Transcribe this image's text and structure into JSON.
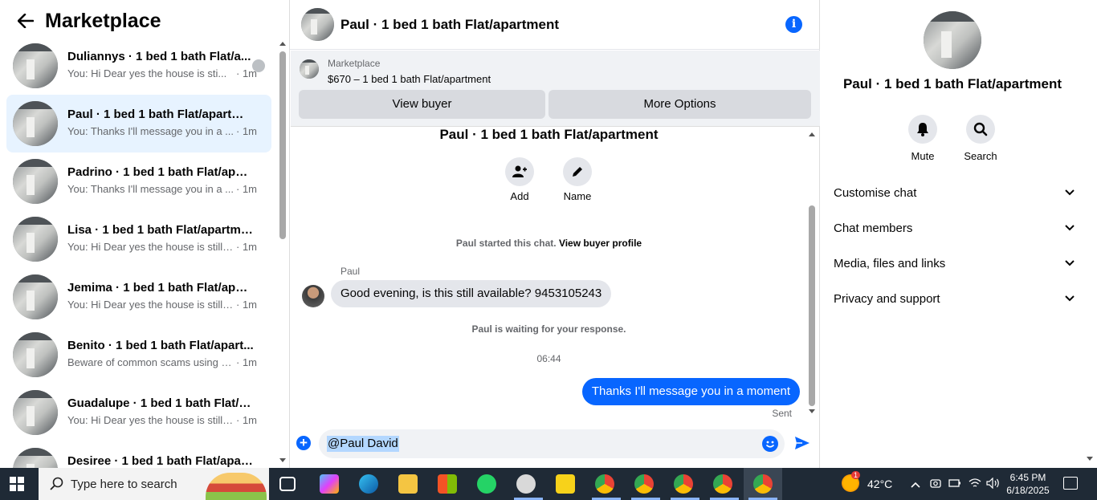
{
  "left": {
    "title": "Marketplace",
    "conversations": [
      {
        "name": "Duliannys · 1 bed 1 bath Flat/a...",
        "preview": "You: Hi Dear yes the house is sti...",
        "time": "· 1m",
        "seen": true
      },
      {
        "name": "Paul · 1 bed 1 bath Flat/apartment",
        "preview": "You: Thanks I'll message you in a ...",
        "time": "· 1m",
        "active": true
      },
      {
        "name": "Padrino · 1 bed 1 bath Flat/apart...",
        "preview": "You: Thanks I'll message you in a ...",
        "time": "· 1m"
      },
      {
        "name": "Lisa · 1 bed 1 bath Flat/apartment",
        "preview": "You: Hi Dear yes the house is still a...",
        "time": "· 1m"
      },
      {
        "name": "Jemima · 1 bed 1 bath Flat/apart...",
        "preview": "You: Hi Dear yes the house is still a...",
        "time": "· 1m"
      },
      {
        "name": "Benito · 1 bed 1 bath Flat/apart...",
        "preview": "Beware of common scams using p...",
        "time": "· 1m"
      },
      {
        "name": "Guadalupe · 1 bed 1 bath Flat/ap...",
        "preview": "You: Hi Dear yes the house is still a...",
        "time": "· 1m"
      },
      {
        "name": "Desiree · 1 bed 1 bath Flat/apart...",
        "preview": "",
        "time": ""
      }
    ]
  },
  "header": {
    "title": "Paul · 1 bed 1 bath Flat/apartment"
  },
  "marketplace_card": {
    "label": "Marketplace",
    "listing": "$670 – 1 bed 1 bath Flat/apartment",
    "view_buyer": "View buyer",
    "more_options": "More Options"
  },
  "chat": {
    "title": "Paul · 1 bed 1 bath Flat/apartment",
    "add_label": "Add",
    "name_label": "Name",
    "started_text": "Paul started this chat.",
    "view_profile": "View buyer profile",
    "sender": "Paul",
    "incoming": "Good evening, is this still available? 9453105243",
    "waiting": "Paul is waiting for your response.",
    "timestamp": "06:44",
    "outgoing": "Thanks I'll message you in a moment",
    "status": "Sent"
  },
  "composer": {
    "value": "@Paul David"
  },
  "right": {
    "name": "Paul · 1 bed 1 bath Flat/apartment",
    "mute": "Mute",
    "search": "Search",
    "sections": [
      "Customise chat",
      "Chat members",
      "Media, files and links",
      "Privacy and support"
    ]
  },
  "taskbar": {
    "search_placeholder": "Type here to search",
    "temperature": "42°C",
    "weather_badge": "1",
    "time": "6:45 PM",
    "date": "6/18/2025"
  },
  "colors": {
    "accent": "#0866ff",
    "active_row": "#e7f3ff",
    "taskbar": "#1f2a36"
  }
}
